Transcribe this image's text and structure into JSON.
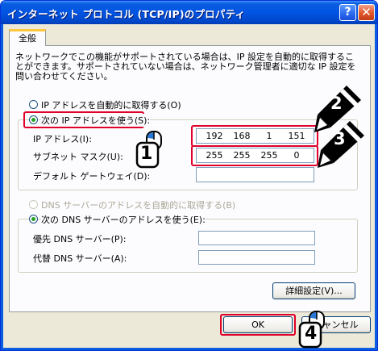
{
  "window": {
    "title": "インターネット プロトコル (TCP/IP)のプロパティ",
    "help_glyph": "?",
    "close_glyph": "✕"
  },
  "tab": {
    "label": "全般"
  },
  "description": "ネットワークでこの機能がサポートされている場合は、IP 設定を自動的に取得することができます。サポートされていない場合は、ネットワーク管理者に適切な IP 設定を問い合わせてください。",
  "ip_mode": {
    "auto_label": "IP アドレスを自動的に取得する(O)",
    "manual_label": "次の IP アドレスを使う(S):",
    "selected": "manual"
  },
  "ip_fields": {
    "ip_label": "IP アドレス(I):",
    "ip_value": [
      "192",
      "168",
      "1",
      "151"
    ],
    "subnet_label": "サブネット マスク(U):",
    "subnet_value": [
      "255",
      "255",
      "255",
      "0"
    ],
    "gateway_label": "デフォルト ゲートウェイ(D):",
    "gateway_value": ""
  },
  "dns_mode": {
    "auto_label": "DNS サーバーのアドレスを自動的に取得する(B)",
    "manual_label": "次の DNS サーバーのアドレスを使う(E):",
    "selected": "manual"
  },
  "dns_fields": {
    "preferred_label": "優先 DNS サーバー(P):",
    "preferred_value": "",
    "alternate_label": "代替 DNS サーバー(A):",
    "alternate_value": ""
  },
  "buttons": {
    "advanced": "詳細設定(V)...",
    "ok": "OK",
    "cancel": "キャンセル"
  },
  "callouts": [
    "1",
    "2",
    "3",
    "4"
  ],
  "colors": {
    "highlight_red": "#e0002a",
    "title_blue": "#0054e3",
    "dialog_bg": "#ece9d8",
    "radio_green": "#21a121"
  }
}
